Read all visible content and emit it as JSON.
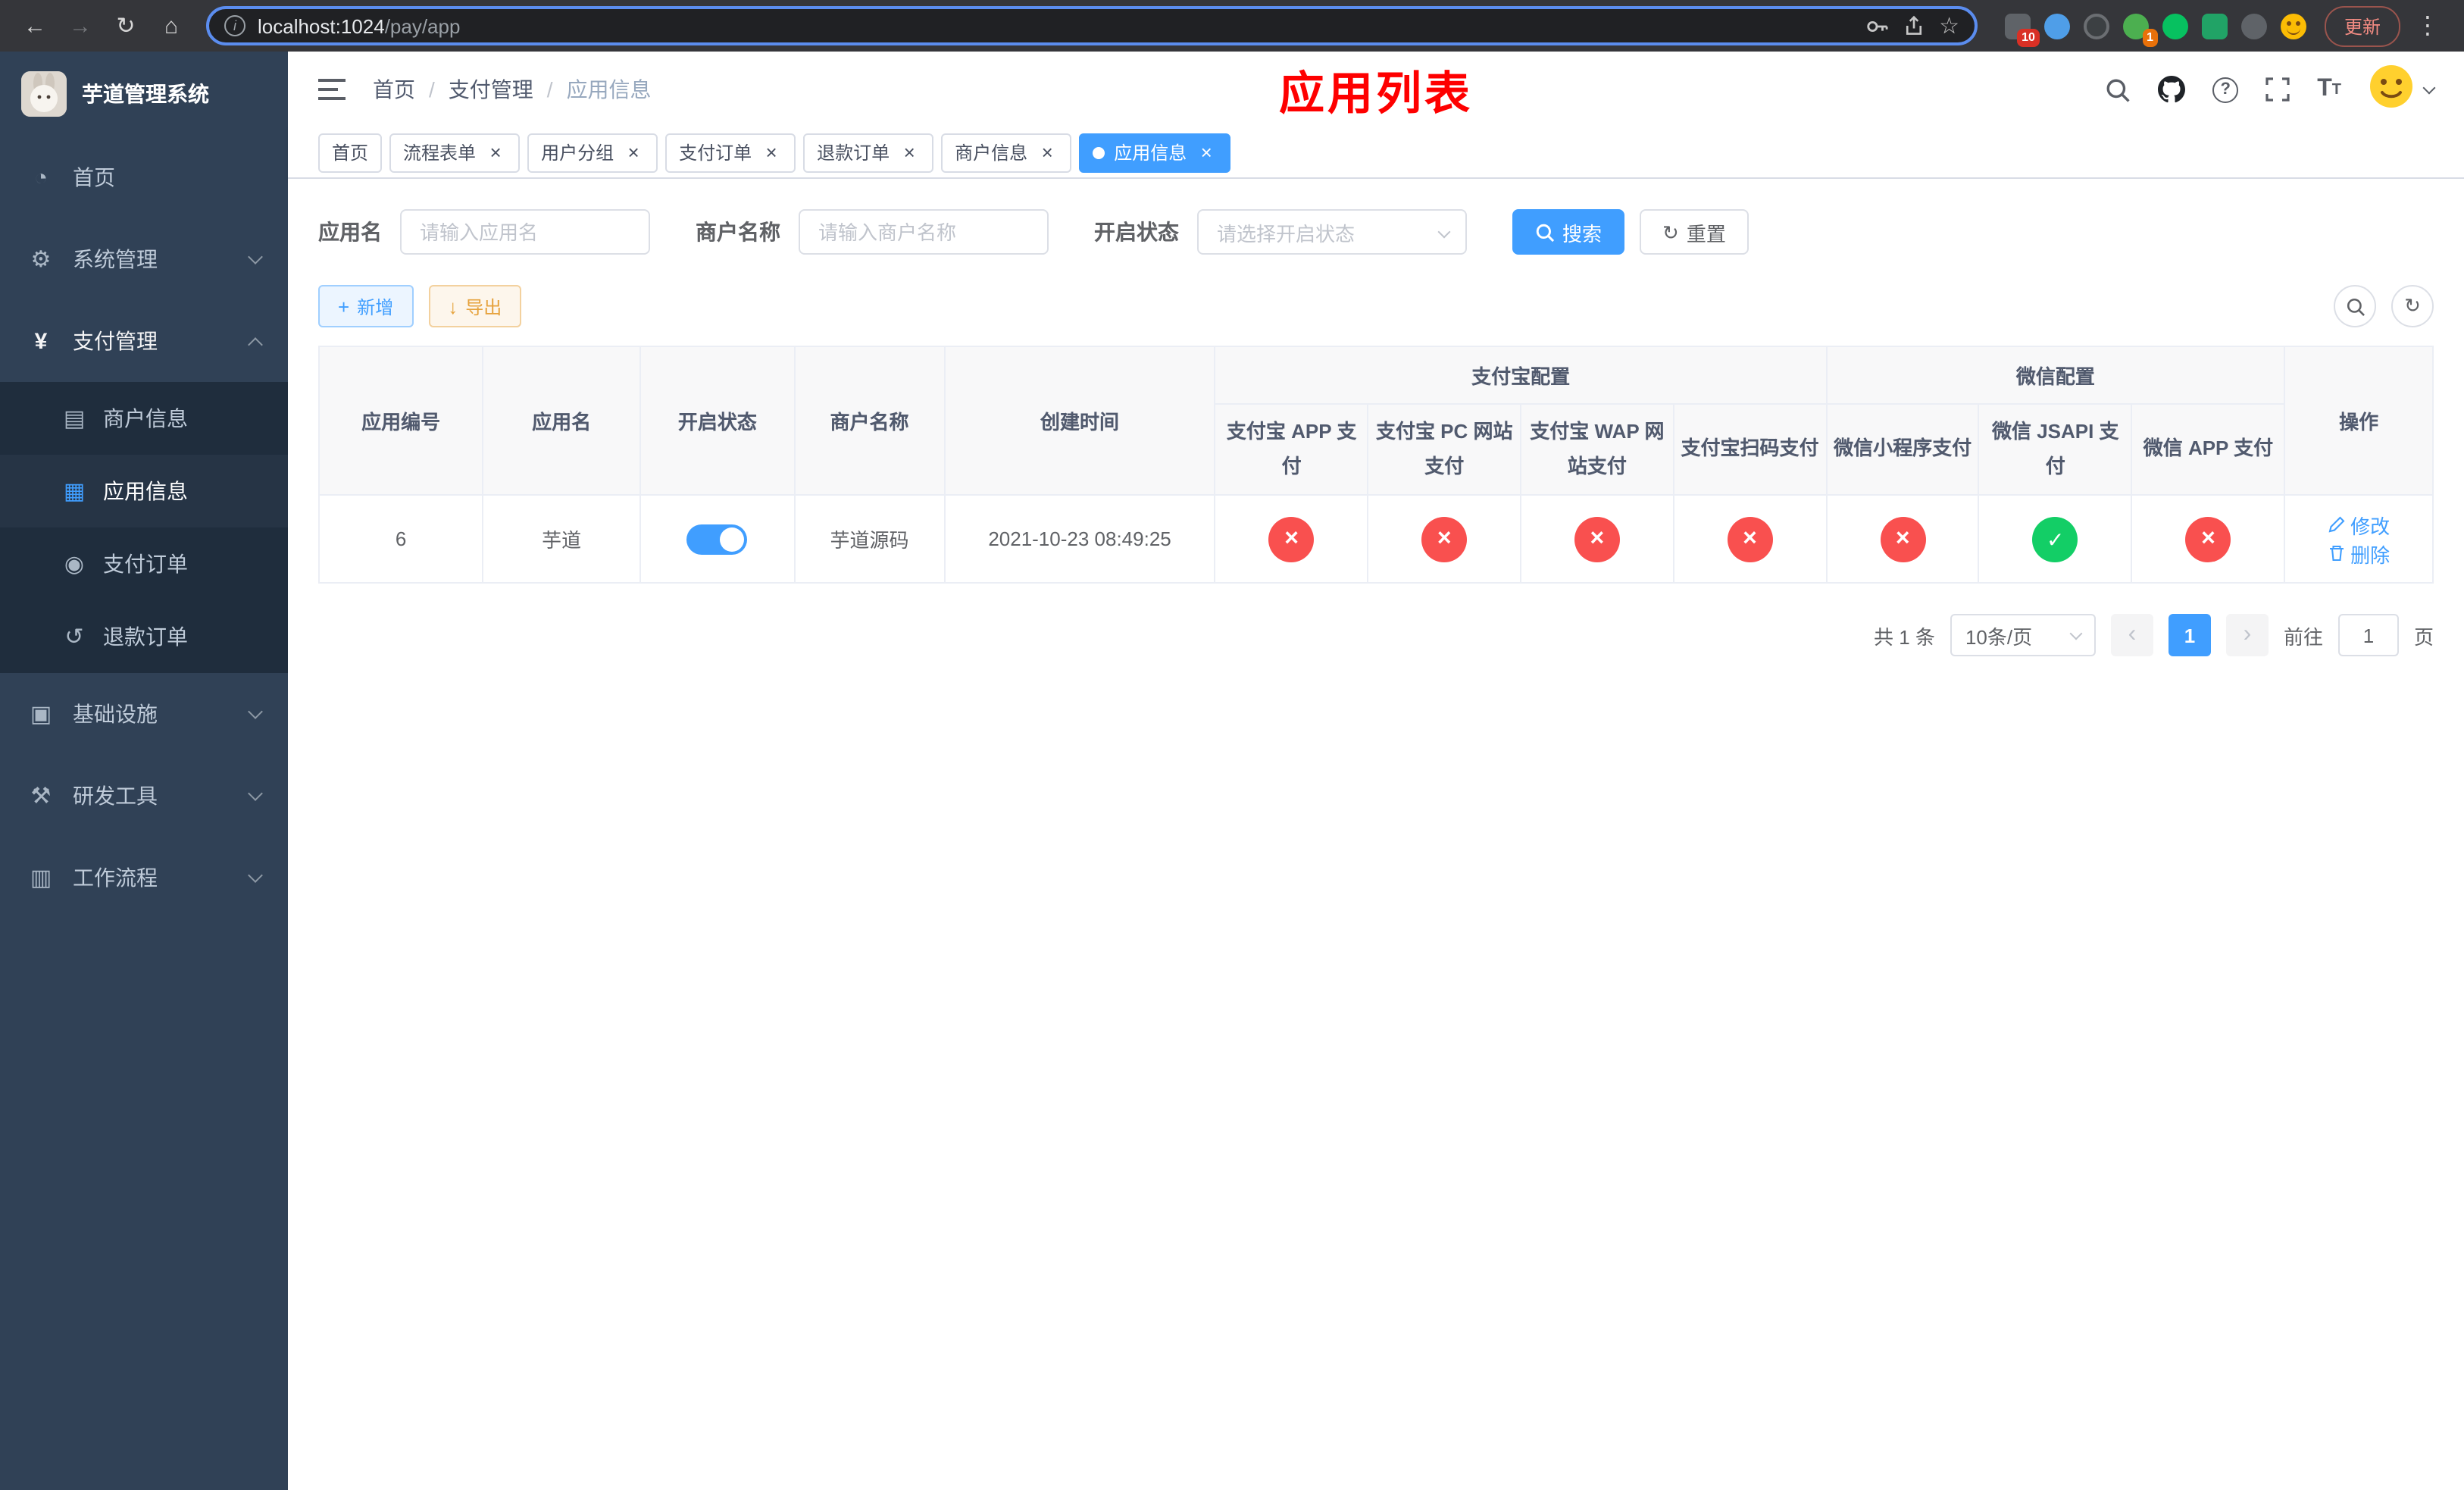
{
  "colors": {
    "accent": "#409eff",
    "danger": "#f9504f",
    "success": "#13ce66",
    "warning": "#e6a23c",
    "title_red": "#fe0000",
    "sidebar_bg": "#304156",
    "submenu_bg": "#1f2d3d"
  },
  "icons": {
    "back": "←",
    "forward": "→",
    "reload": "↻",
    "home": "⌂",
    "star": "☆",
    "more": "⋮",
    "dashboard": "◔",
    "system": "⚙",
    "payment": "¥",
    "merchant": "▤",
    "app_info": "▦",
    "pay_order": "◉",
    "refund_order": "↺",
    "infra": "▣",
    "devtools": "⚒",
    "workflow": "▥",
    "plus": "+",
    "download": "↓",
    "reset": "↻",
    "refresh": "↻",
    "prev": "‹",
    "next": "›"
  },
  "browser": {
    "url_host": "localhost:1024",
    "url_path": "/pay/app",
    "update_label": "更新",
    "ext_badges": {
      "first": "10",
      "second": "1"
    }
  },
  "sidebar": {
    "title": "芋道管理系统",
    "items": {
      "home": "首页",
      "system": "系统管理",
      "payment": "支付管理",
      "merchant_info": "商户信息",
      "app_info": "应用信息",
      "pay_order": "支付订单",
      "refund_order": "退款订单",
      "infra": "基础设施",
      "devtools": "研发工具",
      "workflow": "工作流程"
    }
  },
  "navbar": {
    "breadcrumb": [
      "首页",
      "支付管理",
      "应用信息"
    ],
    "page_title": "应用列表"
  },
  "tabs": [
    {
      "label": "首页"
    },
    {
      "label": "流程表单"
    },
    {
      "label": "用户分组"
    },
    {
      "label": "支付订单"
    },
    {
      "label": "退款订单"
    },
    {
      "label": "商户信息"
    },
    {
      "label": "应用信息",
      "active": true
    }
  ],
  "filters": {
    "app_name_label": "应用名",
    "app_name_placeholder": "请输入应用名",
    "merchant_label": "商户名称",
    "merchant_placeholder": "请输入商户名称",
    "status_label": "开启状态",
    "status_placeholder": "请选择开启状态",
    "search_label": "搜索",
    "reset_label": "重置"
  },
  "toolbar": {
    "add_label": "新增",
    "export_label": "导出"
  },
  "table": {
    "groups": {
      "alipay": "支付宝配置",
      "wechat": "微信配置"
    },
    "columns": {
      "id": "应用编号",
      "name": "应用名",
      "status": "开启状态",
      "merchant": "商户名称",
      "created": "创建时间",
      "alipay_app": "支付宝 APP 支付",
      "alipay_pc": "支付宝 PC 网站支付",
      "alipay_wap": "支付宝 WAP 网站支付",
      "alipay_qr": "支付宝扫码支付",
      "wx_lite": "微信小程序支付",
      "wx_jsapi": "微信 JSAPI 支付",
      "wx_app": "微信 APP 支付",
      "ops": "操作"
    },
    "row": {
      "id": "6",
      "name": "芋道",
      "status": "on",
      "merchant": "芋道源码",
      "created": "2021-10-23 08:49:25",
      "configs": {
        "alipay_app": "no",
        "alipay_pc": "no",
        "alipay_wap": "no",
        "alipay_qr": "no",
        "wx_lite": "no",
        "wx_jsapi": "yes",
        "wx_app": "no"
      },
      "edit_label": "修改",
      "delete_label": "删除"
    }
  },
  "pagination": {
    "total": "共 1 条",
    "page_size": "10条/页",
    "page": "1",
    "goto_label": "前往",
    "goto_value": "1",
    "unit_label": "页"
  }
}
